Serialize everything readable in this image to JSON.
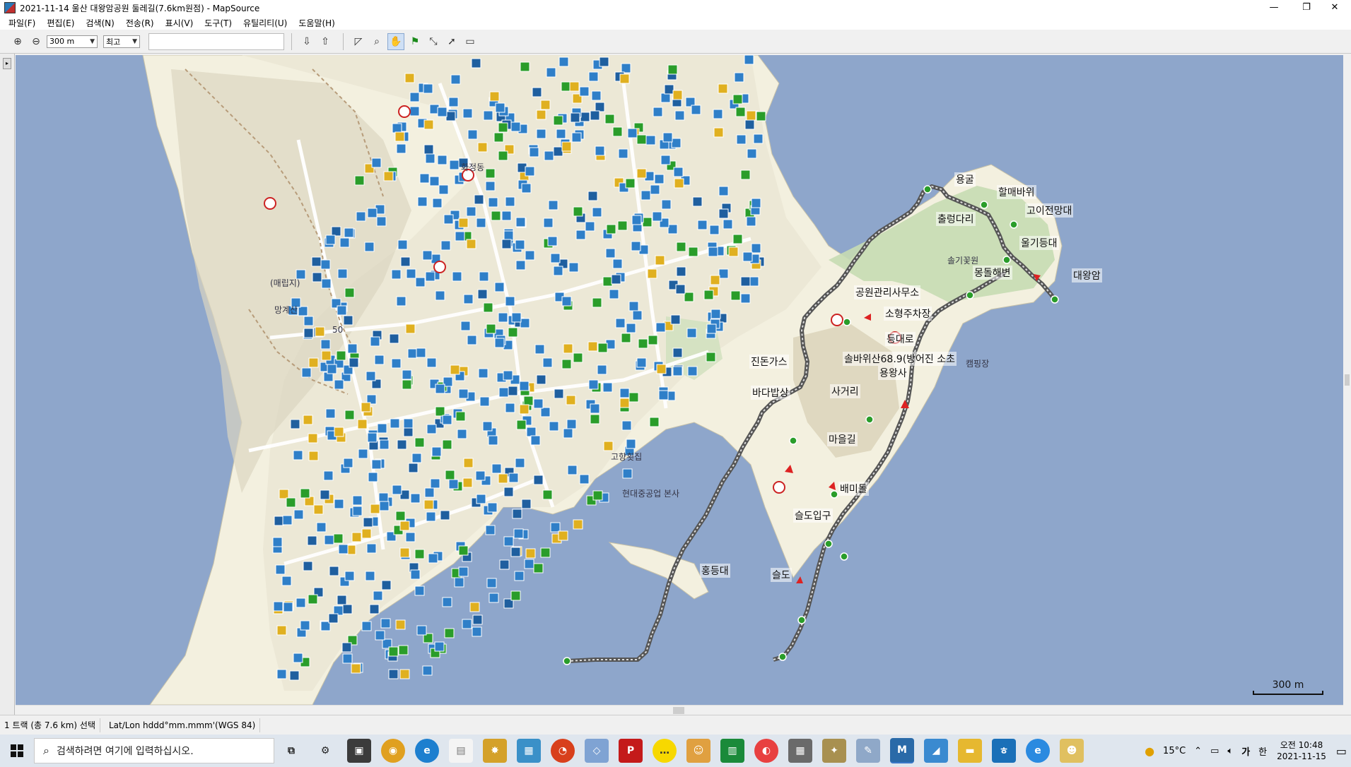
{
  "window": {
    "title": "2021-11-14 울산 대왕암공원 둘레길(7.6km원점) - MapSource",
    "minimize": "—",
    "restore": "❐",
    "close": "✕"
  },
  "menu": [
    "파일(F)",
    "편집(E)",
    "검색(N)",
    "전송(R)",
    "표시(V)",
    "도구(T)",
    "유틸리티(U)",
    "도움말(H)"
  ],
  "toolbar": {
    "zoom_value": "300 m",
    "detail_value": "최고"
  },
  "map": {
    "labels": [
      {
        "text": "용굴"
      },
      {
        "text": "할매바위"
      },
      {
        "text": "고이전망대"
      },
      {
        "text": "출렁다리"
      },
      {
        "text": "울기등대"
      },
      {
        "text": "대왕암"
      },
      {
        "text": "몽돌해변"
      },
      {
        "text": "공원관리사무소"
      },
      {
        "text": "소형주차장"
      },
      {
        "text": "등대로"
      },
      {
        "text": "솔바위산68.9(방어진 소초"
      },
      {
        "text": "용왕사"
      },
      {
        "text": "사거리"
      },
      {
        "text": "마을길"
      },
      {
        "text": "배미돌"
      },
      {
        "text": "슬도입구"
      },
      {
        "text": "슬도"
      },
      {
        "text": "홍등대"
      },
      {
        "text": "진돈가스"
      },
      {
        "text": "바다밥상"
      }
    ],
    "small_labels": [
      {
        "text": "(매립지)"
      },
      {
        "text": "망계산"
      },
      {
        "text": "화정동"
      },
      {
        "text": "50"
      },
      {
        "text": "현대중공업 본사"
      },
      {
        "text": "고향횟집"
      },
      {
        "text": "솔기꽃원"
      },
      {
        "text": "캠핑장"
      }
    ],
    "scale": "300 m"
  },
  "status": {
    "selection": "1 트랙 (총 7.6 km) 선택",
    "format": "Lat/Lon hddd°mm.mmm'(WGS 84)"
  },
  "taskbar": {
    "search_placeholder": "검색하려면 여기에 입력하십시오.",
    "weather": "15°C",
    "ime": "가",
    "ime2": "한",
    "time": "오전 10:48",
    "date": "2021-11-15"
  }
}
